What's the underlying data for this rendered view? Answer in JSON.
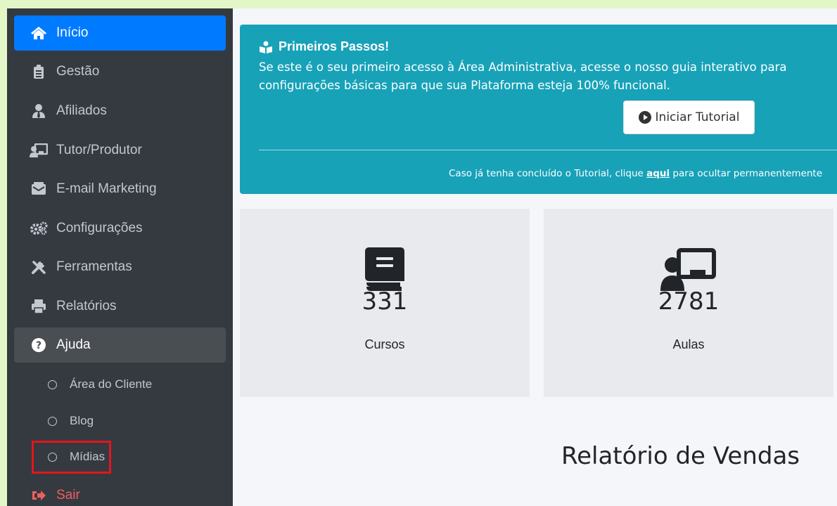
{
  "sidebar": {
    "items": [
      {
        "label": "Início",
        "icon": "home-icon"
      },
      {
        "label": "Gestão",
        "icon": "clipboard-icon"
      },
      {
        "label": "Afiliados",
        "icon": "user-tie-icon"
      },
      {
        "label": "Tutor/Produtor",
        "icon": "chalkboard-teacher-icon"
      },
      {
        "label": "E-mail Marketing",
        "icon": "mail-bulk-icon"
      },
      {
        "label": "Configurações",
        "icon": "cogs-icon"
      },
      {
        "label": "Ferramentas",
        "icon": "tools-icon"
      },
      {
        "label": "Relatórios",
        "icon": "print-icon"
      },
      {
        "label": "Ajuda",
        "icon": "question-circle-icon"
      }
    ],
    "sub_items": [
      {
        "label": "Área do Cliente"
      },
      {
        "label": "Blog"
      },
      {
        "label": "Mídias"
      }
    ],
    "logout": {
      "label": "Sair",
      "icon": "sign-out-icon"
    }
  },
  "banner": {
    "title": "Primeiros Passos!",
    "text": "Se este é o seu primeiro acesso à Área Administrativa, acesse o nosso guia interativo para configurações básicas para que sua Plataforma esteja 100% funcional.",
    "button_label": "Iniciar Tutorial",
    "footer_before": "Caso já tenha concluído o Tutorial, clique ",
    "footer_link": "aqui",
    "footer_after": " para ocultar permanentemente"
  },
  "stats": [
    {
      "value": "331",
      "label": "Cursos",
      "icon": "book-icon"
    },
    {
      "value": "2781",
      "label": "Aulas",
      "icon": "chalkboard-teacher-icon"
    }
  ],
  "report": {
    "title": "Relatório de Vendas"
  },
  "colors": {
    "sidebar": "#343a40",
    "active": "#007bff",
    "banner": "#17a2b8",
    "logout": "#f05f5f",
    "highlight": "#e3161d"
  }
}
